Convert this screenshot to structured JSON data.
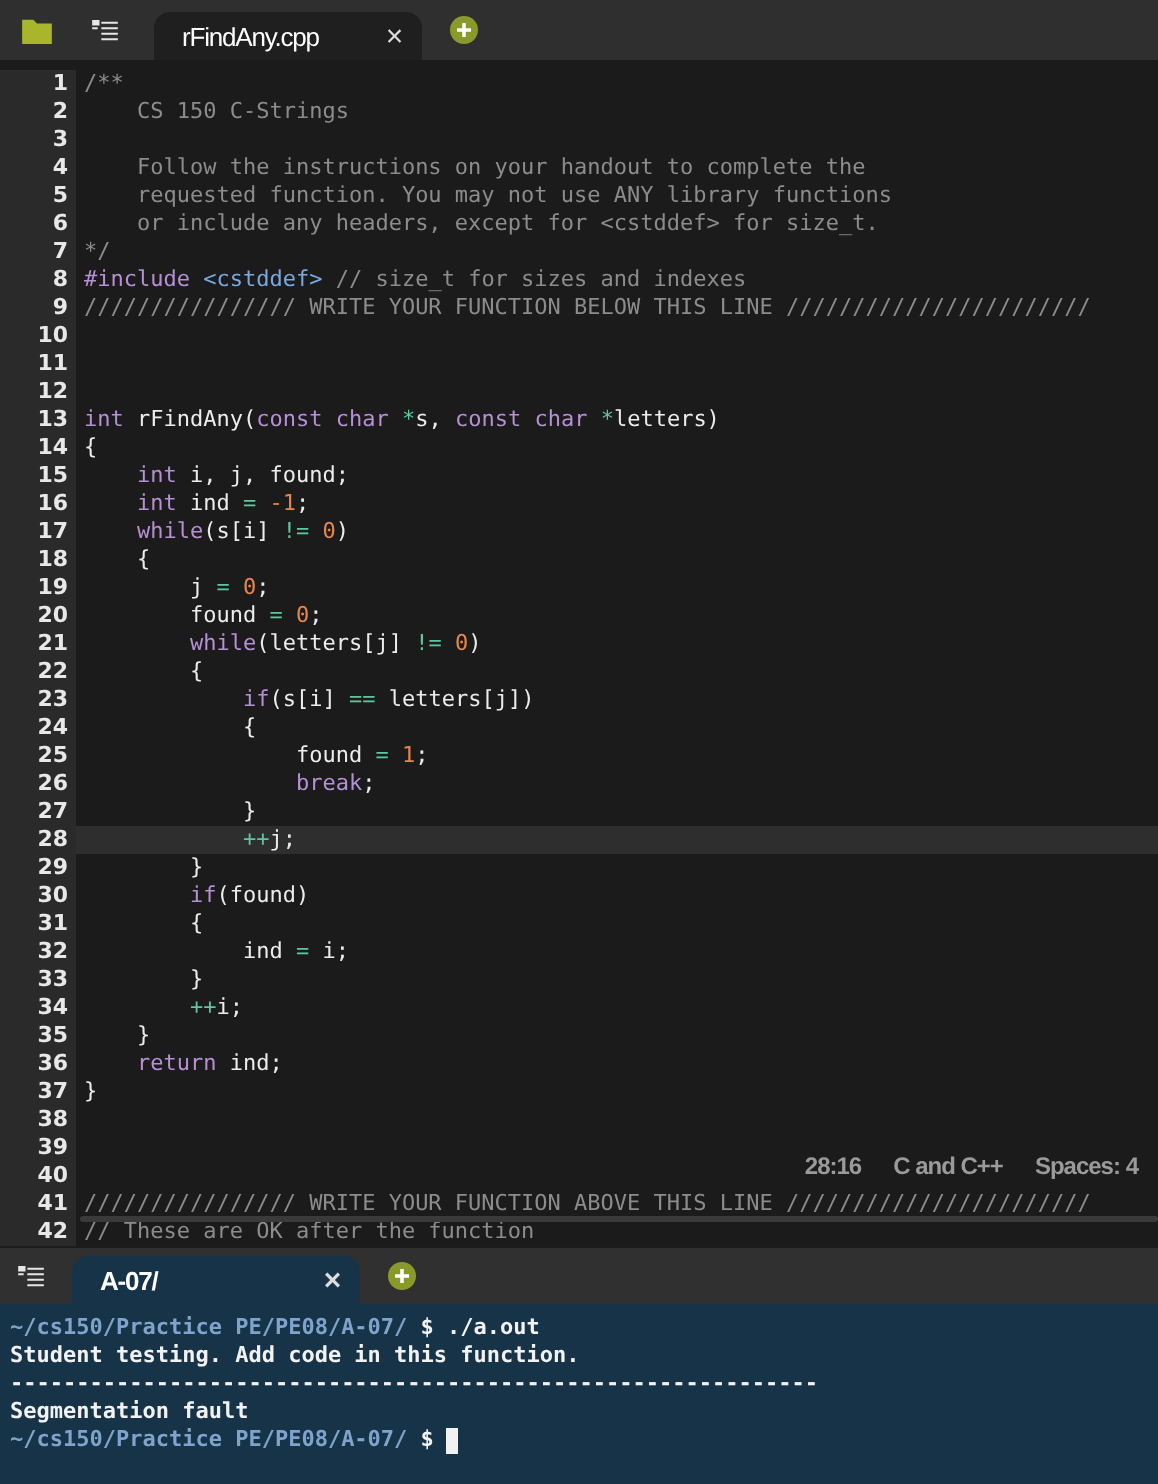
{
  "editor_tabs": [
    {
      "label": "rFindAny.cpp",
      "close": "×",
      "selected": true
    }
  ],
  "editor": {
    "lines": [
      {
        "number": "1",
        "current": false,
        "tokens": [
          {
            "kind": "comment",
            "text": "/**"
          }
        ]
      },
      {
        "number": "2",
        "current": false,
        "tokens": [
          {
            "kind": "comment",
            "text": "    CS 150 C-Strings"
          }
        ]
      },
      {
        "number": "3",
        "current": false
      },
      {
        "number": "4",
        "current": false,
        "tokens": [
          {
            "kind": "comment",
            "text": "    Follow the instructions on your handout to complete the"
          }
        ]
      },
      {
        "number": "5",
        "current": false,
        "tokens": [
          {
            "kind": "comment",
            "text": "    requested function. You may not use ANY library functions"
          }
        ]
      },
      {
        "number": "6",
        "current": false,
        "tokens": [
          {
            "kind": "comment",
            "text": "    or include any headers, except for <cstddef> for size_t."
          }
        ]
      },
      {
        "number": "7",
        "current": false,
        "tokens": [
          {
            "kind": "comment",
            "text": "*/"
          }
        ]
      },
      {
        "number": "8",
        "current": false,
        "tokens": [
          {
            "kind": "keyword",
            "text": "#include"
          },
          {
            "kind": "path",
            "text": " <cstddef>"
          },
          {
            "kind": "comment",
            "text": " // size_t for sizes and indexes"
          }
        ]
      },
      {
        "number": "9",
        "current": false,
        "tokens": [
          {
            "kind": "comment",
            "text": "//////////////// WRITE YOUR FUNCTION BELOW THIS LINE ///////////////////////"
          }
        ]
      },
      {
        "number": "10",
        "current": false
      },
      {
        "number": "11",
        "current": false
      },
      {
        "number": "12",
        "current": false
      },
      {
        "number": "13",
        "current": false,
        "tokens": [
          {
            "kind": "keyword",
            "text": "int"
          },
          {
            "kind": "plain",
            "text": " rFindAny("
          },
          {
            "kind": "keyword",
            "text": "const char"
          },
          {
            "kind": "operator",
            "text": " *"
          },
          {
            "kind": "plain",
            "text": "s, "
          },
          {
            "kind": "keyword",
            "text": "const char"
          },
          {
            "kind": "operator",
            "text": " *"
          },
          {
            "kind": "plain",
            "text": "letters)"
          }
        ]
      },
      {
        "number": "14",
        "current": false,
        "tokens": [
          {
            "kind": "plain",
            "text": "{"
          }
        ]
      },
      {
        "number": "15",
        "current": false,
        "tokens": [
          {
            "kind": "keyword",
            "text": "    int"
          },
          {
            "kind": "plain",
            "text": " i, j, found;"
          }
        ]
      },
      {
        "number": "16",
        "current": false,
        "tokens": [
          {
            "kind": "keyword",
            "text": "    int"
          },
          {
            "kind": "plain",
            "text": " ind"
          },
          {
            "kind": "operator",
            "text": " ="
          },
          {
            "kind": "number",
            "text": " -1"
          },
          {
            "kind": "plain",
            "text": ";"
          }
        ]
      },
      {
        "number": "17",
        "current": false,
        "tokens": [
          {
            "kind": "keyword",
            "text": "    while"
          },
          {
            "kind": "plain",
            "text": "(s[i]"
          },
          {
            "kind": "operator",
            "text": " !="
          },
          {
            "kind": "number",
            "text": " 0"
          },
          {
            "kind": "plain",
            "text": ")"
          }
        ]
      },
      {
        "number": "18",
        "current": false,
        "tokens": [
          {
            "kind": "plain",
            "text": "    {"
          }
        ]
      },
      {
        "number": "19",
        "current": false,
        "tokens": [
          {
            "kind": "plain",
            "text": "        j"
          },
          {
            "kind": "operator",
            "text": " ="
          },
          {
            "kind": "number",
            "text": " 0"
          },
          {
            "kind": "plain",
            "text": ";"
          }
        ]
      },
      {
        "number": "20",
        "current": false,
        "tokens": [
          {
            "kind": "plain",
            "text": "        found"
          },
          {
            "kind": "operator",
            "text": " ="
          },
          {
            "kind": "number",
            "text": " 0"
          },
          {
            "kind": "plain",
            "text": ";"
          }
        ]
      },
      {
        "number": "21",
        "current": false,
        "tokens": [
          {
            "kind": "keyword",
            "text": "        while"
          },
          {
            "kind": "plain",
            "text": "(letters[j]"
          },
          {
            "kind": "operator",
            "text": " !="
          },
          {
            "kind": "number",
            "text": " 0"
          },
          {
            "kind": "plain",
            "text": ")"
          }
        ]
      },
      {
        "number": "22",
        "current": false,
        "tokens": [
          {
            "kind": "plain",
            "text": "        {"
          }
        ]
      },
      {
        "number": "23",
        "current": false,
        "tokens": [
          {
            "kind": "keyword",
            "text": "            if"
          },
          {
            "kind": "plain",
            "text": "(s[i]"
          },
          {
            "kind": "operator",
            "text": " =="
          },
          {
            "kind": "plain",
            "text": " letters[j])"
          }
        ]
      },
      {
        "number": "24",
        "current": false,
        "tokens": [
          {
            "kind": "plain",
            "text": "            {"
          }
        ]
      },
      {
        "number": "25",
        "current": false,
        "tokens": [
          {
            "kind": "plain",
            "text": "                found"
          },
          {
            "kind": "operator",
            "text": " ="
          },
          {
            "kind": "number",
            "text": " 1"
          },
          {
            "kind": "plain",
            "text": ";"
          }
        ]
      },
      {
        "number": "26",
        "current": false,
        "tokens": [
          {
            "kind": "keyword",
            "text": "                break"
          },
          {
            "kind": "plain",
            "text": ";"
          }
        ]
      },
      {
        "number": "27",
        "current": false,
        "tokens": [
          {
            "kind": "plain",
            "text": "            }"
          }
        ]
      },
      {
        "number": "28",
        "current": true,
        "tokens": [
          {
            "kind": "operator",
            "text": "            ++"
          },
          {
            "kind": "plain",
            "text": "j;"
          }
        ]
      },
      {
        "number": "29",
        "current": false,
        "tokens": [
          {
            "kind": "plain",
            "text": "        }"
          }
        ]
      },
      {
        "number": "30",
        "current": false,
        "tokens": [
          {
            "kind": "keyword",
            "text": "        if"
          },
          {
            "kind": "plain",
            "text": "(found)"
          }
        ]
      },
      {
        "number": "31",
        "current": false,
        "tokens": [
          {
            "kind": "plain",
            "text": "        {"
          }
        ]
      },
      {
        "number": "32",
        "current": false,
        "tokens": [
          {
            "kind": "plain",
            "text": "            ind"
          },
          {
            "kind": "operator",
            "text": " ="
          },
          {
            "kind": "plain",
            "text": " i;"
          }
        ]
      },
      {
        "number": "33",
        "current": false,
        "tokens": [
          {
            "kind": "plain",
            "text": "        }"
          }
        ]
      },
      {
        "number": "34",
        "current": false,
        "tokens": [
          {
            "kind": "operator",
            "text": "        ++"
          },
          {
            "kind": "plain",
            "text": "i;"
          }
        ]
      },
      {
        "number": "35",
        "current": false,
        "tokens": [
          {
            "kind": "plain",
            "text": "    }"
          }
        ]
      },
      {
        "number": "36",
        "current": false,
        "tokens": [
          {
            "kind": "keyword",
            "text": "    return"
          },
          {
            "kind": "plain",
            "text": " ind;"
          }
        ]
      },
      {
        "number": "37",
        "current": false,
        "tokens": [
          {
            "kind": "plain",
            "text": "}"
          }
        ]
      },
      {
        "number": "38",
        "current": false
      },
      {
        "number": "39",
        "current": false
      },
      {
        "number": "40",
        "current": false
      },
      {
        "number": "41",
        "current": false,
        "tokens": [
          {
            "kind": "comment",
            "text": "//////////////// WRITE YOUR FUNCTION ABOVE THIS LINE ///////////////////////"
          }
        ]
      },
      {
        "number": "42",
        "current": false,
        "tokens": [
          {
            "kind": "comment",
            "text": "// These are OK after the function"
          }
        ]
      }
    ],
    "status": [
      "28:16",
      "C and C++",
      "Spaces: 4"
    ]
  },
  "terminal_tabs": [
    {
      "label": "A-07/",
      "close": "×",
      "selected": true
    }
  ],
  "terminal": {
    "lines": [
      {
        "kind": "prompt",
        "path": "~/cs150/Practice PE/PE08/A-07/",
        "symbol": "$",
        "command": "./a.out",
        "cursor": false
      },
      {
        "kind": "output",
        "text": "Student testing. Add code in this function."
      },
      {
        "kind": "output",
        "text": "-------------------------------------------------------------"
      },
      {
        "kind": "output",
        "text": "Segmentation fault"
      },
      {
        "kind": "prompt",
        "path": "~/cs150/Practice PE/PE08/A-07/",
        "symbol": "$",
        "cursor": true
      }
    ]
  }
}
